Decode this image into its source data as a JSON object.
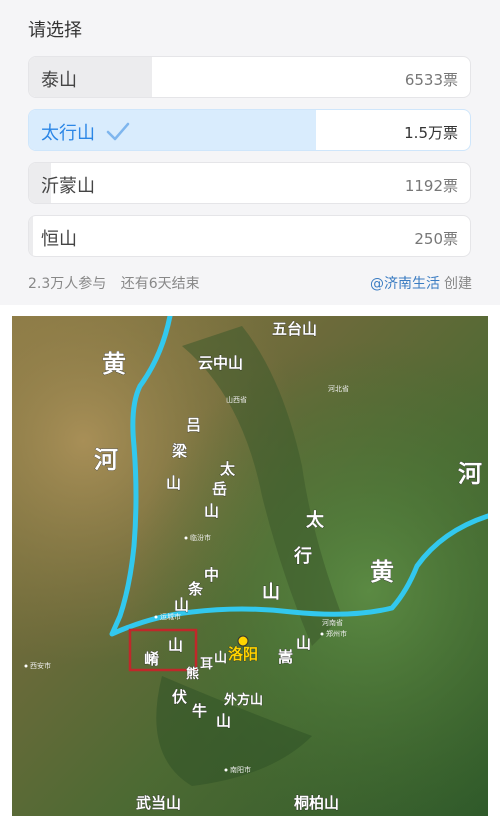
{
  "poll": {
    "title": "请选择",
    "options": [
      {
        "label": "泰山",
        "votes": "6533票",
        "share": 0.28,
        "selected": false
      },
      {
        "label": "太行山",
        "votes": "1.5万票",
        "share": 0.65,
        "selected": true
      },
      {
        "label": "沂蒙山",
        "votes": "1192票",
        "share": 0.05,
        "selected": false
      },
      {
        "label": "恒山",
        "votes": "250票",
        "share": 0.01,
        "selected": false
      }
    ],
    "participants": "2.3万人参与",
    "remaining": "还有6天结束",
    "creator_handle": "@济南生活",
    "creator_suffix": "创建"
  },
  "map": {
    "labels": {
      "wutaishan": "五台山",
      "yunzhongshan": "云中山",
      "lvliang": [
        "吕",
        "梁",
        "山"
      ],
      "taiyue": [
        "太",
        "岳",
        "山"
      ],
      "taihang": [
        "太",
        "行",
        "山"
      ],
      "zhongtiao": [
        "中",
        "条",
        "山"
      ],
      "yaoshan": [
        "崤",
        "山"
      ],
      "luoyang": "洛阳",
      "songshan": [
        "嵩",
        "山"
      ],
      "xiong_er": [
        "熊",
        "耳",
        "山"
      ],
      "funiu": [
        "伏",
        "牛",
        "山"
      ],
      "waifang": "外方山",
      "wudang": "武当山",
      "tongbai": "桐柏山",
      "huang_left": "黄",
      "he_left": "河",
      "huang_right": "黄",
      "he_right": "河",
      "small_cities": {
        "shanxi": "山西省",
        "hebei": "河北省",
        "henan": "河南省",
        "zhengzhou": "郑州市",
        "linfen": "临汾市",
        "yuncheng": "运城市",
        "xian": "西安市",
        "nanyang": "南阳市"
      }
    },
    "colors": {
      "river": "#32c8ee",
      "box": "#c0282a",
      "luoyang_text": "#ffd400"
    }
  }
}
